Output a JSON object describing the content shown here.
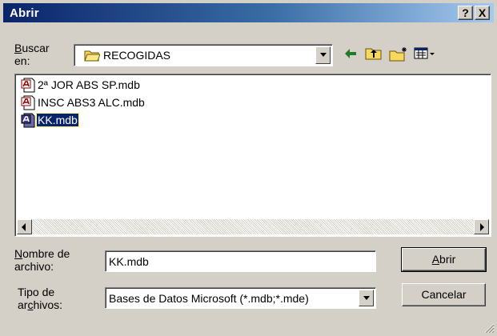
{
  "window": {
    "title": "Abrir",
    "help_label": "?",
    "close_label": "X"
  },
  "lookin": {
    "label_line1": "Buscar",
    "label_line2": "en:",
    "folder_name": "RECOGIDAS",
    "toolbar": [
      "back-icon",
      "up-folder-icon",
      "new-folder-icon",
      "view-menu-icon"
    ]
  },
  "files": [
    {
      "name": "2ª JOR ABS SP.mdb",
      "icon": "access-db-icon",
      "selected": false
    },
    {
      "name": "INSC ABS3 ALC.mdb",
      "icon": "access-db-icon",
      "selected": false
    },
    {
      "name": "KK.mdb",
      "icon": "access-db-icon",
      "selected": true
    }
  ],
  "filename": {
    "label_line1": "Nombre de",
    "label_line2": "archivo:",
    "value": "KK.mdb"
  },
  "filetype": {
    "label_line1": "Tipo de",
    "label_line2": "archivos:",
    "selected": "Bases de Datos Microsoft (*.mdb;*.mde)"
  },
  "buttons": {
    "open_label": "Abrir",
    "cancel_label": "Cancelar"
  },
  "colors": {
    "face": "#d4d0c8",
    "title_start": "#0a246a",
    "title_end": "#a6caf0",
    "selection": "#0a246a"
  }
}
